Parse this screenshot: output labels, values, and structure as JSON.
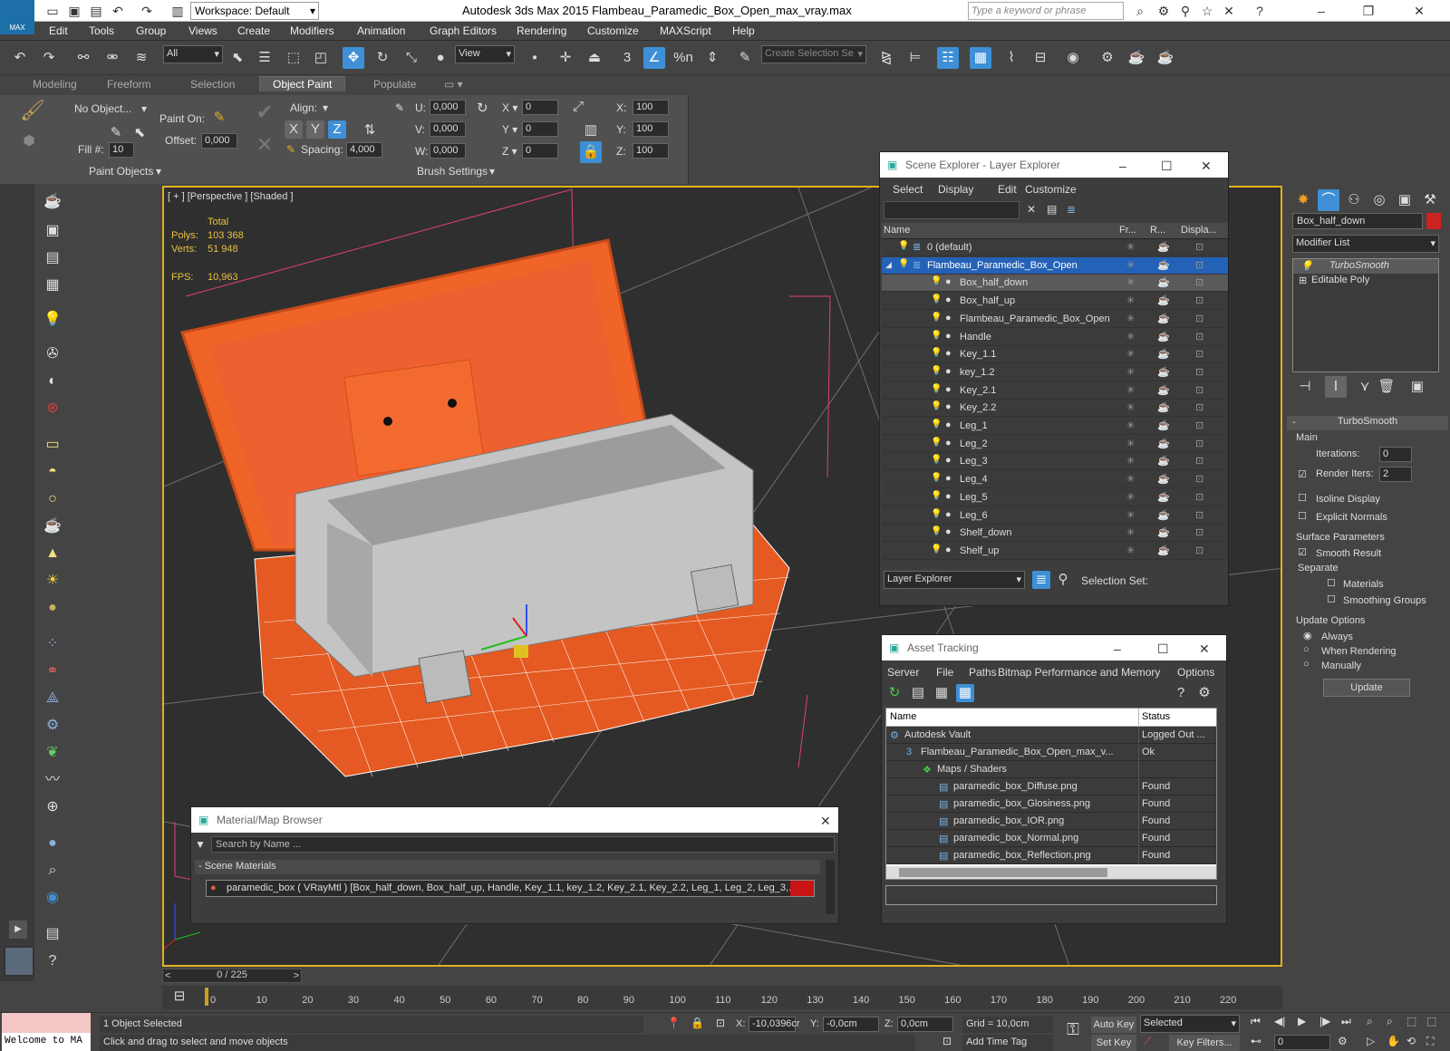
{
  "app": {
    "title": "Autodesk 3ds Max  2015     Flambeau_Paramedic_Box_Open_max_vray.max",
    "logo": "MAX",
    "workspace": "Workspace: Default",
    "search_placeholder": "Type a keyword or phrase"
  },
  "menu": [
    "Edit",
    "Tools",
    "Group",
    "Views",
    "Create",
    "Modifiers",
    "Animation",
    "Graph Editors",
    "Rendering",
    "Customize",
    "MAXScript",
    "Help"
  ],
  "toolbar": {
    "filter": "All",
    "refcoord": "View",
    "named_sel": "Create Selection Se",
    "snap_num": "3",
    "angle": "%n"
  },
  "ribbon": {
    "tabs": [
      "Modeling",
      "Freeform",
      "Selection",
      "Object Paint",
      "Populate"
    ],
    "active_tab": "Object Paint",
    "no_object": "No Object...",
    "paint_on": "Paint On:",
    "offset_label": "Offset:",
    "offset_val": "0,000",
    "fill_label": "Fill #:",
    "fill_val": "10",
    "align": "Align:",
    "x": "X",
    "y": "Y",
    "z": "Z",
    "spacing_label": "Spacing:",
    "spacing_val": "4,000",
    "u_label": "U:",
    "u_val": "0,000",
    "v_label": "V:",
    "v_val": "0,000",
    "w_label": "W:",
    "w_val": "0,000",
    "rx": "0",
    "ry": "0",
    "rz": "0",
    "sx": "100",
    "sy": "100",
    "sz": "100",
    "group1": "Paint Objects",
    "group2": "Brush Settings"
  },
  "viewport": {
    "label": "[ + ] [Perspective ] [Shaded ]",
    "total": "Total",
    "polys_label": "Polys:",
    "polys": "103 368",
    "verts_label": "Verts:",
    "verts": "51 948",
    "fps_label": "FPS:",
    "fps": "10,963"
  },
  "scene_explorer": {
    "title": "Scene Explorer - Layer Explorer",
    "menu": [
      "Select",
      "Display",
      "Edit",
      "Customize"
    ],
    "cols": [
      "Name",
      "Fr...",
      "R...",
      "Displa..."
    ],
    "rows": [
      "0 (default)",
      "Flambeau_Paramedic_Box_Open",
      "Box_half_down",
      "Box_half_up",
      "Flambeau_Paramedic_Box_Open",
      "Handle",
      "Key_1.1",
      "key_1.2",
      "Key_2.1",
      "Key_2.2",
      "Leg_1",
      "Leg_2",
      "Leg_3",
      "Leg_4",
      "Leg_5",
      "Leg_6",
      "Shelf_down",
      "Shelf_up"
    ],
    "footer_layer": "Layer Explorer",
    "footer_sel": "Selection Set:"
  },
  "asset_tracking": {
    "title": "Asset Tracking",
    "menu": [
      "Server",
      "File",
      "Paths",
      "Bitmap Performance and Memory",
      "Options"
    ],
    "cols": [
      "Name",
      "Status"
    ],
    "rows": [
      {
        "name": "Autodesk Vault",
        "status": "Logged Out ..."
      },
      {
        "name": "Flambeau_Paramedic_Box_Open_max_v...",
        "status": "Ok"
      },
      {
        "name": "Maps / Shaders",
        "status": ""
      },
      {
        "name": "paramedic_box_Diffuse.png",
        "status": "Found"
      },
      {
        "name": "paramedic_box_Glosiness.png",
        "status": "Found"
      },
      {
        "name": "paramedic_box_IOR.png",
        "status": "Found"
      },
      {
        "name": "paramedic_box_Normal.png",
        "status": "Found"
      },
      {
        "name": "paramedic_box_Reflection.png",
        "status": "Found"
      }
    ]
  },
  "mat_browser": {
    "title": "Material/Map Browser",
    "search": "Search by Name ...",
    "section": "- Scene Materials",
    "item": "paramedic_box  ( VRayMtl ) [Box_half_down, Box_half_up, Handle, Key_1.1, key_1.2, Key_2.1, Key_2.2, Leg_1, Leg_2, Leg_3,..."
  },
  "cmd": {
    "obj_name": "Box_half_down",
    "mod_list": "Modifier List",
    "stack": [
      "TurboSmooth",
      "Editable Poly"
    ],
    "rollout": "TurboSmooth",
    "main": "Main",
    "iter_label": "Iterations:",
    "iter": "0",
    "render_label": "Render Iters:",
    "render": "2",
    "isoline": "Isoline Display",
    "explicit": "Explicit Normals",
    "surface": "Surface Parameters",
    "smooth": "Smooth Result",
    "separate": "Separate",
    "materials": "Materials",
    "smgroups": "Smoothing Groups",
    "update_opts": "Update Options",
    "always": "Always",
    "when": "When Rendering",
    "manually": "Manually",
    "update": "Update",
    "accent": "#cc2222"
  },
  "timeline": {
    "frame": "0 / 225",
    "ticks": [
      "0",
      "10",
      "20",
      "30",
      "40",
      "50",
      "60",
      "70",
      "80",
      "90",
      "100",
      "110",
      "120",
      "130",
      "140",
      "150",
      "160",
      "170",
      "180",
      "190",
      "200",
      "210",
      "220"
    ]
  },
  "status": {
    "welcome": "Welcome to MA",
    "selected": "1 Object Selected",
    "hint": "Click and drag to select and move objects",
    "x_label": "X:",
    "x": "-10,0396cr",
    "y_label": "Y:",
    "y": "-0,0cm",
    "z_label": "Z:",
    "z": "0,0cm",
    "grid": "Grid = 10,0cm",
    "autokey": "Auto Key",
    "setkey": "Set Key",
    "sel_mode": "Selected",
    "keyfilters": "Key Filters...",
    "addtime": "Add Time Tag",
    "frame": "0"
  }
}
